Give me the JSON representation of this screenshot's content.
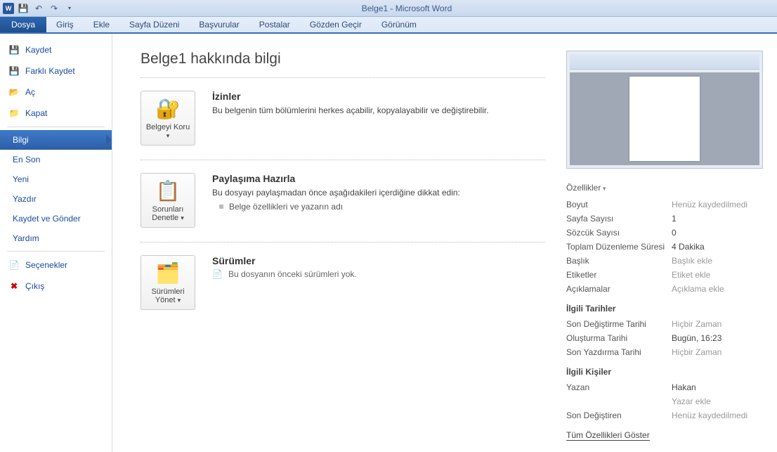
{
  "title": "Belge1  -  Microsoft Word",
  "ribbon_tabs": {
    "file": "Dosya",
    "home": "Giriş",
    "insert": "Ekle",
    "layout": "Sayfa Düzeni",
    "references": "Başvurular",
    "mailings": "Postalar",
    "review": "Gözden Geçir",
    "view": "Görünüm"
  },
  "nav": {
    "save": "Kaydet",
    "save_as": "Farklı Kaydet",
    "open": "Aç",
    "close": "Kapat",
    "info": "Bilgi",
    "recent": "En Son",
    "new": "Yeni",
    "print": "Yazdır",
    "save_send": "Kaydet ve Gönder",
    "help": "Yardım",
    "options": "Seçenekler",
    "exit": "Çıkış"
  },
  "main": {
    "heading": "Belge1 hakkında bilgi",
    "protect": {
      "btn": "Belgeyi Koru",
      "title": "İzinler",
      "desc": "Bu belgenin tüm bölümlerini herkes açabilir, kopyalayabilir ve değiştirebilir."
    },
    "check": {
      "btn": "Sorunları Denetle",
      "title": "Paylaşıma Hazırla",
      "desc": "Bu dosyayı paylaşmadan önce aşağıdakileri içerdiğine dikkat edin:",
      "bullet1": "Belge özellikleri ve yazarın adı"
    },
    "versions": {
      "btn": "Sürümleri Yönet",
      "title": "Sürümler",
      "desc": "Bu dosyanın önceki sürümleri yok."
    }
  },
  "props": {
    "header": "Özellikler",
    "rows": {
      "size": {
        "label": "Boyut",
        "value": "Henüz kaydedilmedi"
      },
      "pages": {
        "label": "Sayfa Sayısı",
        "value": "1"
      },
      "words": {
        "label": "Sözcük Sayısı",
        "value": "0"
      },
      "edit_time": {
        "label": "Toplam Düzenleme Süresi",
        "value": "4 Dakika"
      },
      "title": {
        "label": "Başlık",
        "value": "Başlık ekle"
      },
      "tags": {
        "label": "Etiketler",
        "value": "Etiket ekle"
      },
      "comments": {
        "label": "Açıklamalar",
        "value": "Açıklama ekle"
      }
    },
    "dates_header": "İlgili Tarihler",
    "dates": {
      "modified": {
        "label": "Son Değiştirme Tarihi",
        "value": "Hiçbir Zaman"
      },
      "created": {
        "label": "Oluşturma Tarihi",
        "value": "Bugün, 16:23"
      },
      "printed": {
        "label": "Son Yazdırma Tarihi",
        "value": "Hiçbir Zaman"
      }
    },
    "people_header": "İlgili Kişiler",
    "people": {
      "author": {
        "label": "Yazan",
        "value": "Hakan",
        "add": "Yazar ekle"
      },
      "last_mod_by": {
        "label": "Son Değiştiren",
        "value": "Henüz kaydedilmedi"
      }
    },
    "show_all": "Tüm Özellikleri Göster"
  }
}
